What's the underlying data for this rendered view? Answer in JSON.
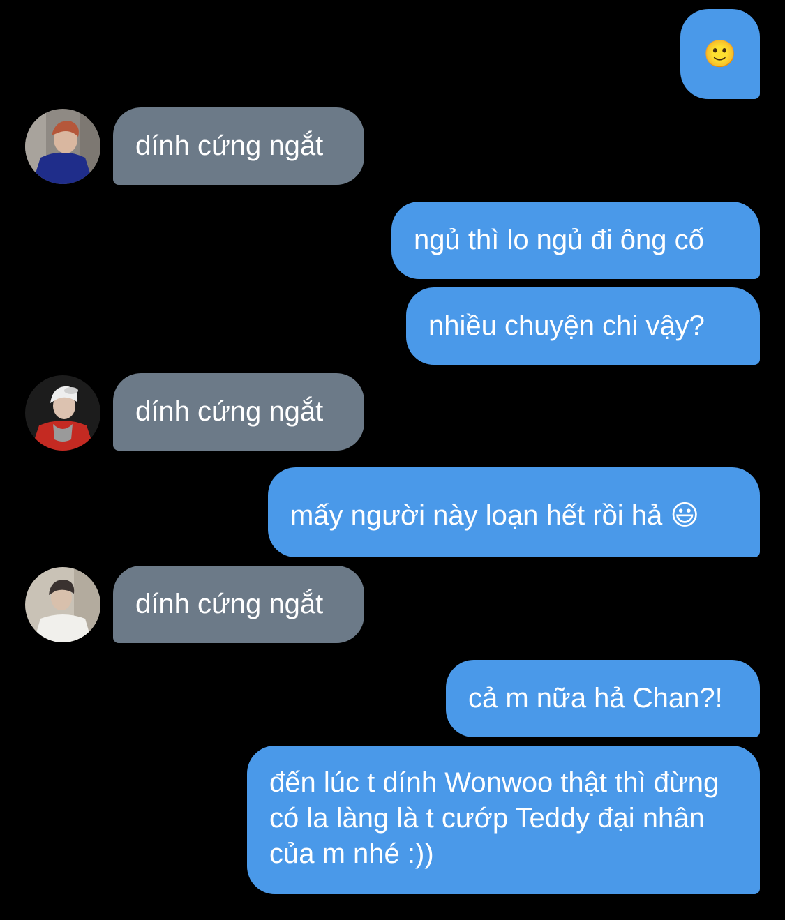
{
  "chat": {
    "messages": [
      {
        "id": "m1",
        "side": "sent",
        "text": "🙂"
      },
      {
        "id": "m2",
        "side": "received",
        "text": "dính cứng ngắt"
      },
      {
        "id": "m3",
        "side": "sent",
        "text": "ngủ thì lo ngủ đi ông cố"
      },
      {
        "id": "m4",
        "side": "sent",
        "text": "nhiều chuyện chi vậy?"
      },
      {
        "id": "m5",
        "side": "received",
        "text": "dính cứng ngắt"
      },
      {
        "id": "m6",
        "side": "sent",
        "text": "mấy người này loạn hết rồi hả 😃"
      },
      {
        "id": "m7",
        "side": "received",
        "text": "dính cứng ngắt"
      },
      {
        "id": "m8",
        "side": "sent",
        "text": "cả m nữa hả Chan?!"
      },
      {
        "id": "m9",
        "side": "sent",
        "text": "đến lúc t dính Wonwoo thật thì đừng có la làng là t cướp Teddy đại nhân của m nhé :))"
      }
    ]
  },
  "colors": {
    "background": "#000000",
    "sent_bubble": "#4a99e9",
    "received_bubble": "#6c7a88",
    "text": "#ffffff"
  }
}
